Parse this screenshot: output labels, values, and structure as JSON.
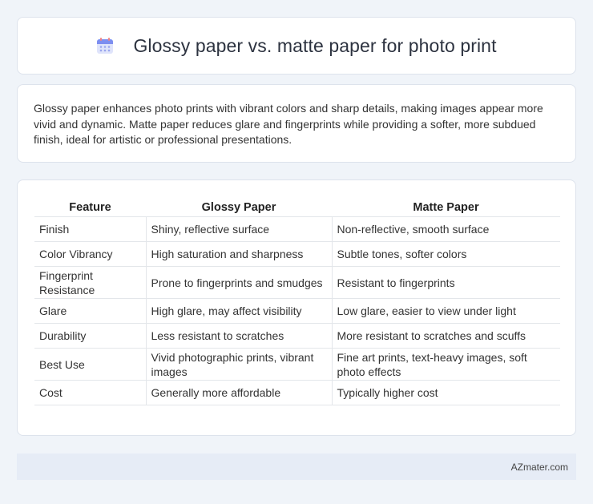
{
  "header": {
    "title": "Glossy paper vs. matte paper for photo print",
    "icon": "calendar-icon"
  },
  "intro": {
    "text": "Glossy paper enhances photo prints with vibrant colors and sharp details, making images appear more vivid and dynamic. Matte paper reduces glare and fingerprints while providing a softer, more subdued finish, ideal for artistic or professional presentations."
  },
  "table": {
    "headers": [
      "Feature",
      "Glossy Paper",
      "Matte Paper"
    ],
    "rows": [
      [
        "Finish",
        "Shiny, reflective surface",
        "Non-reflective, smooth surface"
      ],
      [
        "Color Vibrancy",
        "High saturation and sharpness",
        "Subtle tones, softer colors"
      ],
      [
        "Fingerprint Resistance",
        "Prone to fingerprints and smudges",
        "Resistant to fingerprints"
      ],
      [
        "Glare",
        "High glare, may affect visibility",
        "Low glare, easier to view under light"
      ],
      [
        "Durability",
        "Less resistant to scratches",
        "More resistant to scratches and scuffs"
      ],
      [
        "Best Use",
        "Vivid photographic prints, vibrant images",
        "Fine art prints, text-heavy images, soft photo effects"
      ],
      [
        "Cost",
        "Generally more affordable",
        "Typically higher cost"
      ]
    ]
  },
  "footer": {
    "text": "AZmater.com"
  },
  "colors": {
    "background": "#f0f4f9",
    "card": "#ffffff",
    "footer_bg": "#e6ecf6"
  }
}
